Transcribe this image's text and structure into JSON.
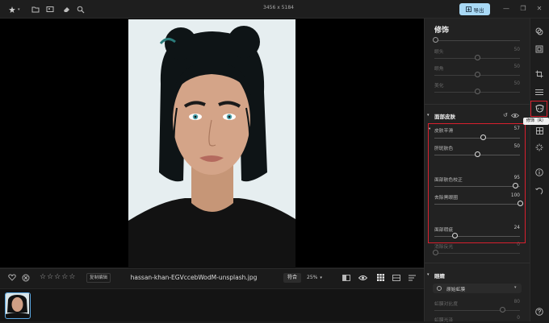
{
  "topbar": {
    "icons": [
      "star-icon",
      "folder-icon",
      "image-icon",
      "eraser-icon",
      "zoom-icon"
    ],
    "dimensions": "3456 x 5184",
    "save_label": "导出"
  },
  "bottombar": {
    "edit_copy_label": "复制编辑",
    "filename": "hassan-khan-EGVccebWodM-unsplash.jpg",
    "fit_label": "符合",
    "zoom_label": "25%",
    "rating": 0
  },
  "panel": {
    "title": "修饰",
    "upper_sliders": [
      {
        "label": "眼头",
        "value": "50"
      },
      {
        "label": "眼角",
        "value": "50"
      },
      {
        "label": "美化",
        "value": "50"
      }
    ],
    "face_skin": {
      "title": "面部皮肤",
      "sliders": [
        {
          "label": "皮肤平滑",
          "value": "57",
          "pos": 0.57
        },
        {
          "label": "肝斑肤色",
          "value": "50",
          "pos": 0.5
        },
        {
          "label": "面部肤色校正",
          "value": "95",
          "pos": 0.95
        },
        {
          "label": "去除黑眼圈",
          "value": "100",
          "pos": 1.0
        },
        {
          "label": "面部瑕疵",
          "value": "24",
          "pos": 0.24
        }
      ],
      "after": {
        "label": "消除反光",
        "value": "0",
        "pos": 0.0
      }
    },
    "eyes": {
      "title": "眼睛",
      "select_label": "原始虹膜",
      "sliders": [
        {
          "label": "虹膜对比度",
          "value": "80"
        },
        {
          "label": "虹膜光泽",
          "value": "0"
        }
      ]
    }
  },
  "rail": {
    "tooltip": "修饰（R）"
  },
  "colors": {
    "accent": "#a9d9f5",
    "highlight": "#d8202e",
    "thumb_border": "#5aa6e0"
  }
}
